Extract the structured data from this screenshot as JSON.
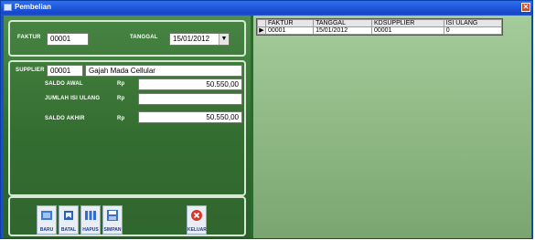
{
  "window": {
    "title": "Pembelian"
  },
  "header_panel": {
    "faktur_label": "FAKTUR",
    "faktur_value": "00001",
    "tanggal_label": "TANGGAL",
    "tanggal_value": "15/01/2012"
  },
  "detail_panel": {
    "supplier_label": "SUPPLIER",
    "supplier_code": "00001",
    "supplier_name": "Gajah Mada Cellular",
    "saldo_awal_label": "SALDO AWAL",
    "saldo_awal_currency": "Rp",
    "saldo_awal_value": "50.550,00",
    "jumlah_label": "JUMLAH ISI ULANG",
    "jumlah_currency": "Rp",
    "jumlah_value": "",
    "saldo_akhir_label": "SALDO AKHIR",
    "saldo_akhir_currency": "Rp",
    "saldo_akhir_value": "50.550,00"
  },
  "toolbar": {
    "baru": "BARU",
    "batal": "BATAL",
    "hapus": "HAPUS",
    "simpan": "SIMPAN",
    "keluar": "KELUAR"
  },
  "grid": {
    "columns": [
      "FAKTUR",
      "TANGGAL",
      "KDSUPPLIER",
      "ISI ULANG"
    ],
    "rows": [
      {
        "faktur": "00001",
        "tanggal": "15/01/2012",
        "kdsupplier": "00001",
        "isi_ulang": "0"
      }
    ],
    "row_indicator": "▶"
  }
}
